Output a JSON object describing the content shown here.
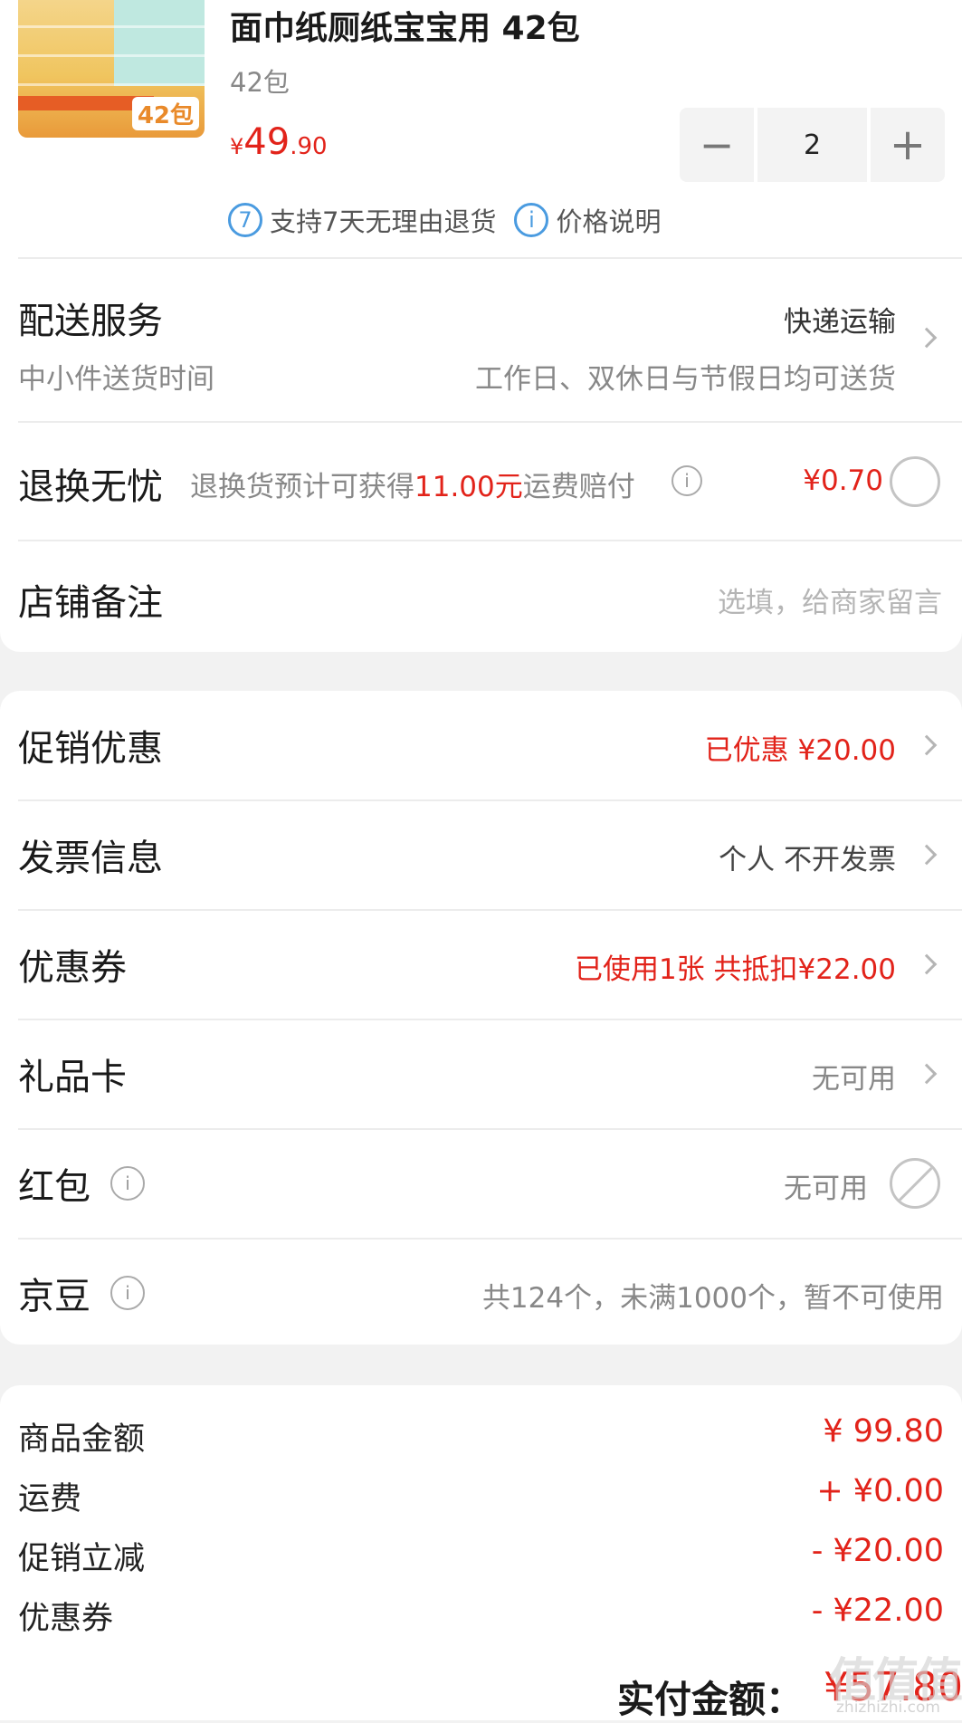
{
  "product": {
    "title": "面巾纸厕纸宝宝用 42包",
    "spec": "42包",
    "price": {
      "symbol": "¥",
      "integer": "49",
      "decimal": ".90"
    },
    "quantity": "2",
    "thumb_badge": "42包",
    "assurances": [
      {
        "icon_text": "7",
        "label": "支持7天无理由退货"
      },
      {
        "icon_text": "i",
        "label": "价格说明"
      }
    ]
  },
  "delivery": {
    "label": "配送服务",
    "method": "快递运输",
    "sub_label": "中小件送货时间",
    "sub_value": "工作日、双休日与节假日均可送货"
  },
  "returns": {
    "label": "退换无忧",
    "desc_prefix": "退换货预计可获得",
    "desc_highlight": "11.00元",
    "desc_suffix": "运费赔付",
    "price": "¥0.70"
  },
  "shop_note": {
    "label": "店铺备注",
    "placeholder": "选填，给商家留言"
  },
  "promotions": {
    "label": "促销优惠",
    "value": "已优惠 ¥20.00"
  },
  "invoice": {
    "label": "发票信息",
    "value": "个人 不开发票"
  },
  "coupons": {
    "label": "优惠券",
    "value": "已使用1张 共抵扣¥22.00"
  },
  "gift_card": {
    "label": "礼品卡",
    "value": "无可用"
  },
  "red_packet": {
    "label": "红包",
    "value": "无可用"
  },
  "jd_beans": {
    "label": "京豆",
    "value": "共124个，未满1000个，暂不可使用"
  },
  "summary": {
    "items": [
      {
        "label": "商品金额",
        "value": "¥ 99.80"
      },
      {
        "label": "运费",
        "value": "+ ¥0.00"
      },
      {
        "label": "促销立减",
        "value": "- ¥20.00"
      },
      {
        "label": "优惠券",
        "value": "- ¥22.00"
      }
    ],
    "total_label": "实付金额：",
    "total_value": "¥57.80"
  },
  "watermark": {
    "main": "值值值",
    "sub": "zhizhizhi.com"
  },
  "colors": {
    "accent_red": "#e2231a",
    "info_blue": "#4a9be0"
  }
}
